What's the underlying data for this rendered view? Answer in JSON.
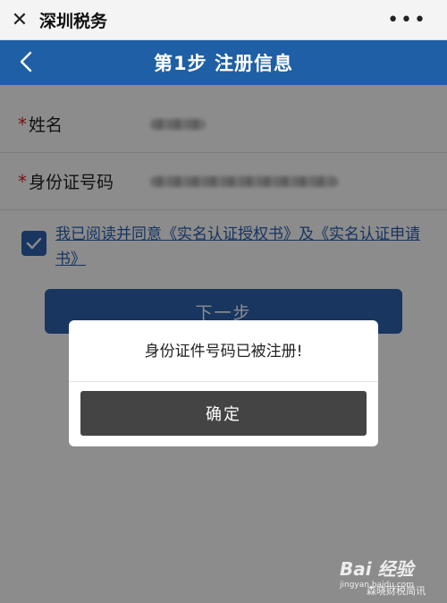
{
  "topbar": {
    "close_glyph": "✕",
    "title": "深圳税务",
    "more_glyph": "•••"
  },
  "nav": {
    "title": "第1步 注册信息"
  },
  "form": {
    "name_label": "姓名",
    "id_label": "身份证号码",
    "required_mark": "*"
  },
  "agreement": {
    "text": "我已阅读并同意《实名认证授权书》及《实名认证申请书》",
    "checked": true
  },
  "next_button": {
    "label": "下一步"
  },
  "dialog": {
    "message": "身份证件号码已被注册!",
    "confirm_label": "确定"
  },
  "watermark": {
    "brand": "Bai 经验",
    "sub": "jingyan.baidu.com",
    "right": "森晓财税简讯"
  },
  "colors": {
    "primary": "#1e5fa6",
    "button": "#2c63b0",
    "dialog_button": "#444444",
    "required": "#dd2222"
  }
}
